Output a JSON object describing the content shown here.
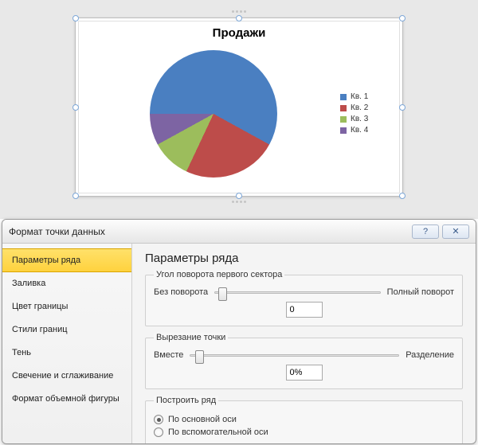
{
  "chart_data": {
    "type": "pie",
    "title": "Продажи",
    "series": [
      {
        "name": "Кв. 1",
        "value": 58,
        "color": "#4a7fc1"
      },
      {
        "name": "Кв. 2",
        "value": 24,
        "color": "#bd4c4a"
      },
      {
        "name": "Кв. 3",
        "value": 10,
        "color": "#9cbd5c"
      },
      {
        "name": "Кв. 4",
        "value": 8,
        "color": "#7d64a3"
      }
    ]
  },
  "dialog": {
    "title": "Формат точки данных",
    "help_symbol": "?",
    "close_symbol": "✕",
    "sidebar": {
      "items": [
        {
          "label": "Параметры ряда",
          "active": true
        },
        {
          "label": "Заливка"
        },
        {
          "label": "Цвет границы"
        },
        {
          "label": "Стили границ"
        },
        {
          "label": "Тень"
        },
        {
          "label": "Свечение и сглаживание"
        },
        {
          "label": "Формат объемной фигуры"
        }
      ]
    },
    "panel": {
      "heading": "Параметры ряда",
      "group1": {
        "legend": "Угол поворота первого сектора",
        "left_label": "Без поворота",
        "right_label": "Полный поворот",
        "value": "0",
        "slider_pos_pct": 2
      },
      "group2": {
        "legend": "Вырезание точки",
        "left_label": "Вместе",
        "right_label": "Разделение",
        "value": "0%",
        "slider_pos_pct": 2
      },
      "group3": {
        "legend": "Построить ряд",
        "opt1": "По основной оси",
        "opt2": "По вспомогательной оси"
      }
    }
  }
}
